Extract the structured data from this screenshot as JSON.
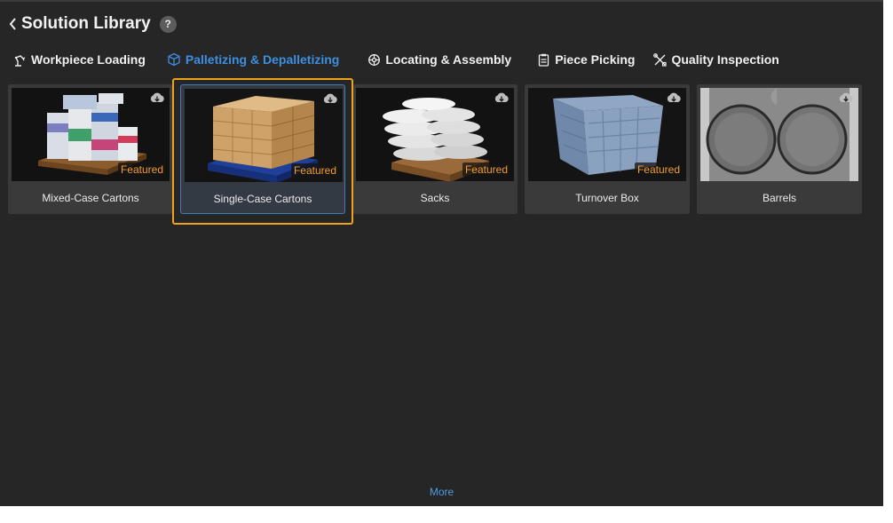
{
  "header": {
    "title": "Solution Library",
    "help_label": "?"
  },
  "tabs": [
    {
      "label": "Workpiece Loading",
      "icon": "robot-arm-icon"
    },
    {
      "label": "Palletizing & Depalletizing",
      "icon": "cube-icon",
      "active": true
    },
    {
      "label": "Locating & Assembly",
      "icon": "gear-icon"
    },
    {
      "label": "Piece Picking",
      "icon": "clipboard-icon"
    },
    {
      "label": "Quality Inspection",
      "icon": "tools-icon"
    }
  ],
  "cards": [
    {
      "label": "Mixed-Case Cartons",
      "badge": "Featured"
    },
    {
      "label": "Single-Case Cartons",
      "badge": "Featured",
      "selected": true
    },
    {
      "label": "Sacks",
      "badge": "Featured"
    },
    {
      "label": "Turnover Box",
      "badge": "Featured"
    },
    {
      "label": "Barrels",
      "badge": ""
    }
  ],
  "footer": {
    "more_label": "More"
  },
  "colors": {
    "accent": "#3d8fe0",
    "featured": "#f39c2a",
    "selection": "#f0a21c",
    "background": "#262626"
  }
}
